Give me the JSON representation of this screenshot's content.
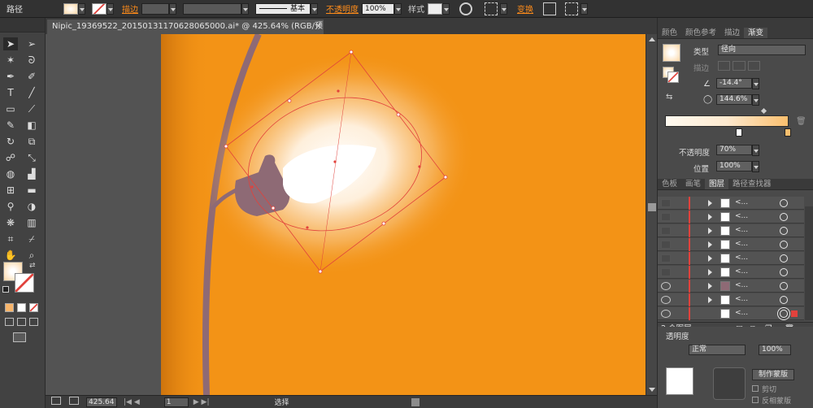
{
  "control_bar": {
    "title": "路径",
    "stroke_label": "描边",
    "stroke_style": "基本",
    "opacity_label": "不透明度",
    "opacity_value": "100%",
    "style_label": "样式",
    "transform_label": "变换"
  },
  "document": {
    "tab_title": "Nipic_19369522_20150131170628065000.ai* @ 425.64% (RGB/预览)",
    "close": "×"
  },
  "status": {
    "zoom": "425.64",
    "page": "1",
    "mode": "选择"
  },
  "panels": {
    "top_tabs": [
      "颜色",
      "颜色参考",
      "描边",
      "渐变"
    ],
    "gradient": {
      "type_label": "类型",
      "type_value": "径向",
      "stroke_label": "描边",
      "angle_value": "-14.4°",
      "aspect_value": "144.6%",
      "opacity_label": "不透明度",
      "opacity_value": "70%",
      "location_label": "位置",
      "location_value": "100%"
    },
    "layer_tabs": [
      "色板",
      "画笔",
      "图层",
      "路径查找器"
    ],
    "layer_row_name": "<...",
    "layers_count": "2 个图层",
    "transparency_title": "透明度",
    "transparency_mode": "正常",
    "transparency_opacity": "100%",
    "make_mask": "制作蒙版",
    "clip": "剪切",
    "invert_mask": "反相蒙版"
  },
  "colors": {
    "artboard": "#f39316",
    "selection": "#e1423c",
    "lamp_body": "#8e6a75",
    "accent": "#ff8c1a"
  },
  "icons": {
    "tools": [
      "selection-tool-icon",
      "direct-selection-tool-icon",
      "magic-wand-icon",
      "lasso-icon",
      "pen-tool-icon",
      "curvature-icon",
      "type-tool-icon",
      "line-tool-icon",
      "rectangle-tool-icon",
      "paintbrush-icon",
      "pencil-icon",
      "eraser-icon",
      "rotate-icon",
      "scale-icon",
      "warp-icon",
      "free-transform-icon",
      "shape-builder-icon",
      "chart-icon",
      "mesh-icon",
      "gradient-tool-icon",
      "eyedropper-icon",
      "blend-icon",
      "symbol-sprayer-icon",
      "column-graph-icon",
      "artboard-tool-icon",
      "slice-icon",
      "hand-tool-icon",
      "zoom-tool-icon"
    ]
  }
}
